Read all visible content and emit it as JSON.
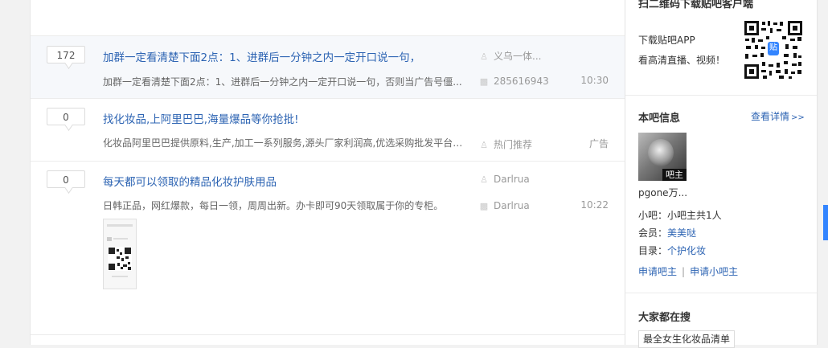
{
  "threads": [
    {
      "reply_count": "172",
      "title": "加群一定看清楚下面2点：1、进群后一分钟之内一定开口说一句，",
      "abstract": "加群一定看清楚下面2点：1、进群后一分钟之内一定开口说一句，否则当广告号僵...",
      "author": "义乌一体...",
      "last_replier": "285616943",
      "time": "10:30"
    },
    {
      "reply_count": "0",
      "title": "找化妆品,上阿里巴巴,海量爆品等你抢批!",
      "abstract": "化妆品阿里巴巴提供原料,生产,加工一系列服务,源头厂家利润高,优选采购批发平台阿...",
      "author": "热门推荐",
      "time": "广告"
    },
    {
      "reply_count": "0",
      "title": "每天都可以领取的精品化妆护肤用品",
      "abstract": "日韩正品，网红爆款，每日一领，周周出新。办卡即可90天领取属于你的专柜。",
      "author": "Darlrua",
      "last_replier": "Darlrua",
      "time": "10:22"
    }
  ],
  "sidebar": {
    "qr_heading": "扫二维码下载贴吧客户端",
    "app_line1": "下载贴吧APP",
    "app_line2": "看高清直播、视频！",
    "qr_logo": "贴",
    "info_title": "本吧信息",
    "info_detail": "查看详情",
    "moderator_badge": "吧主",
    "moderator_name": "pgone万...",
    "small_moderator_label": "小吧：",
    "small_moderator_value": "小吧主共1人",
    "member_label": "会员：",
    "member_value": "美美哒",
    "catalog_label": "目录：",
    "catalog_value": "个护化妆",
    "apply_moderator": "申请吧主",
    "apply_small_moderator": "申请小吧主",
    "search_title": "大家都在搜",
    "search_tag": "最全女生化妆品清单"
  },
  "icons": {
    "author": "user-icon",
    "last_reply": "comment-icon",
    "double_chevron": "chevron-right-double-icon"
  },
  "colors": {
    "link": "#2d64b3",
    "scroll_marker": "#3385ff"
  }
}
